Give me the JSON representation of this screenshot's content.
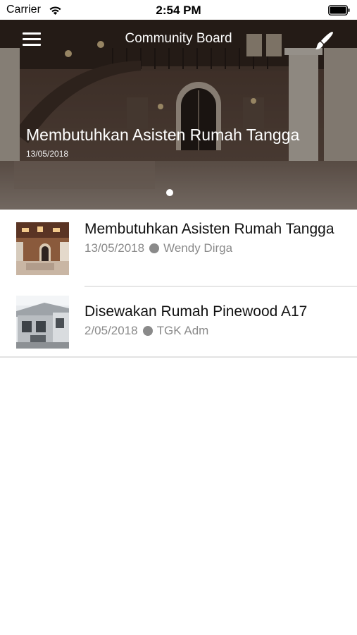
{
  "status_bar": {
    "carrier": "Carrier",
    "time": "2:54 PM"
  },
  "nav": {
    "title": "Community Board",
    "menu_icon": "hamburger-menu-icon",
    "action_icon": "paintbrush-icon"
  },
  "hero": {
    "title": "Membutuhkan Asisten Rumah Tangga",
    "date": "13/05/2018",
    "page_count": 1,
    "current_page": 1
  },
  "posts": [
    {
      "title": "Membutuhkan Asisten Rumah Tangga",
      "date": "13/05/2018",
      "author": "Wendy Dirga"
    },
    {
      "title": "Disewakan Rumah Pinewood A17",
      "date": "2/05/2018",
      "author": "TGK Adm"
    }
  ],
  "colors": {
    "meta_text": "#8a8a8a",
    "divider": "#e6e6e6"
  }
}
